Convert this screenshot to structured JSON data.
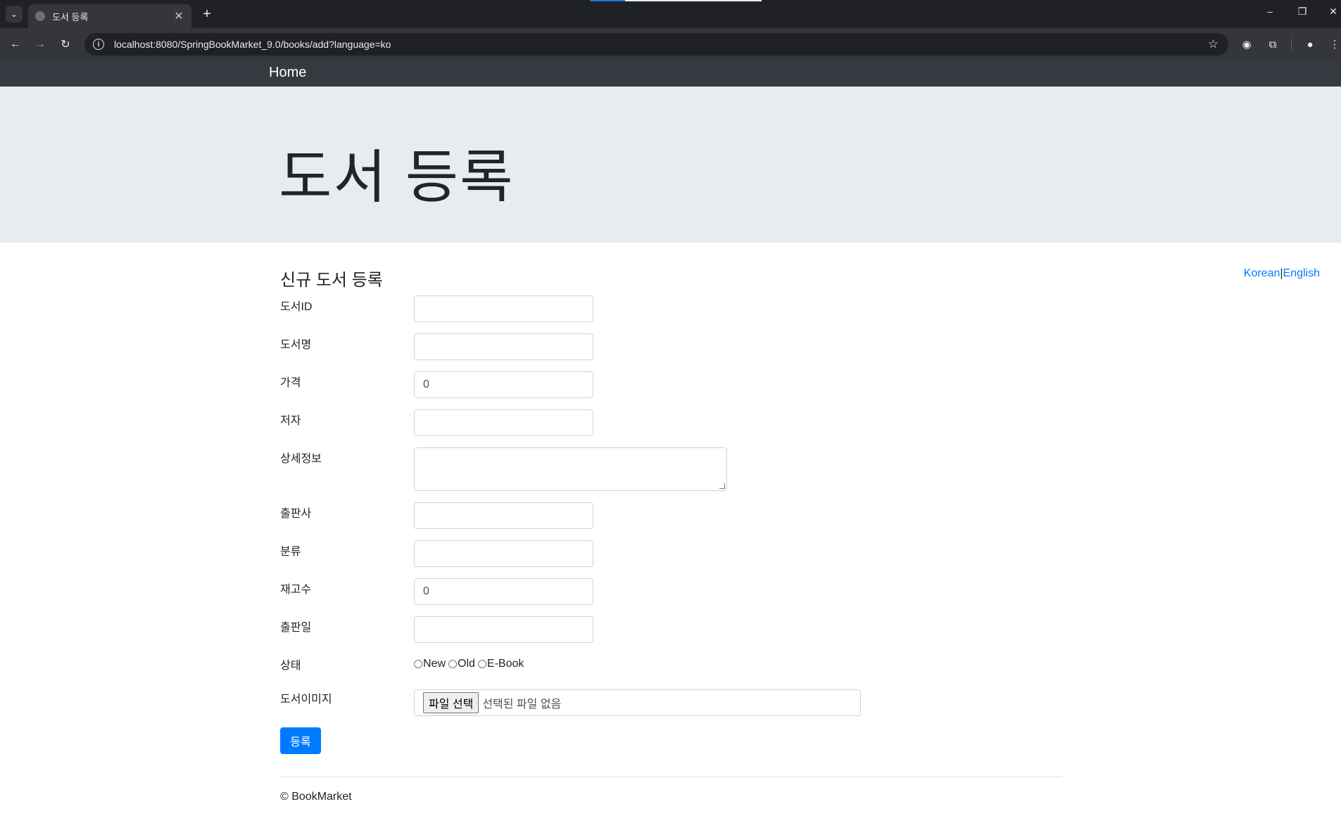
{
  "browser": {
    "tab_title": "도서 등록",
    "tab_close": "✕",
    "new_tab": "+",
    "url": "localhost:8080/SpringBookMarket_9.0/books/add?language=ko",
    "window_controls": {
      "minimize": "–",
      "restore": "❐",
      "close": "✕"
    }
  },
  "navbar": {
    "brand": "Home"
  },
  "jumbotron": {
    "title": "도서 등록"
  },
  "language": {
    "korean": "Korean",
    "separator": "|",
    "english": "English"
  },
  "form": {
    "heading": "신규 도서 등록",
    "fields": [
      {
        "label": "도서ID",
        "value": ""
      },
      {
        "label": "도서명",
        "value": ""
      },
      {
        "label": "가격",
        "value": "0"
      },
      {
        "label": "저자",
        "value": ""
      },
      {
        "label": "상세정보",
        "value": ""
      },
      {
        "label": "출판사",
        "value": ""
      },
      {
        "label": "분류",
        "value": ""
      },
      {
        "label": "재고수",
        "value": "0"
      },
      {
        "label": "출판일",
        "value": ""
      }
    ],
    "condition": {
      "label": "상태",
      "options": [
        "New",
        "Old",
        "E-Book"
      ]
    },
    "image": {
      "label": "도서이미지",
      "button": "파일 선택",
      "no_file": "선택된 파일 없음"
    },
    "submit": "등록"
  },
  "footer": {
    "text": "© BookMarket"
  },
  "colors": {
    "navbar": "#343a40",
    "jumbotron": "#e9ecef",
    "primary": "#007bff"
  }
}
